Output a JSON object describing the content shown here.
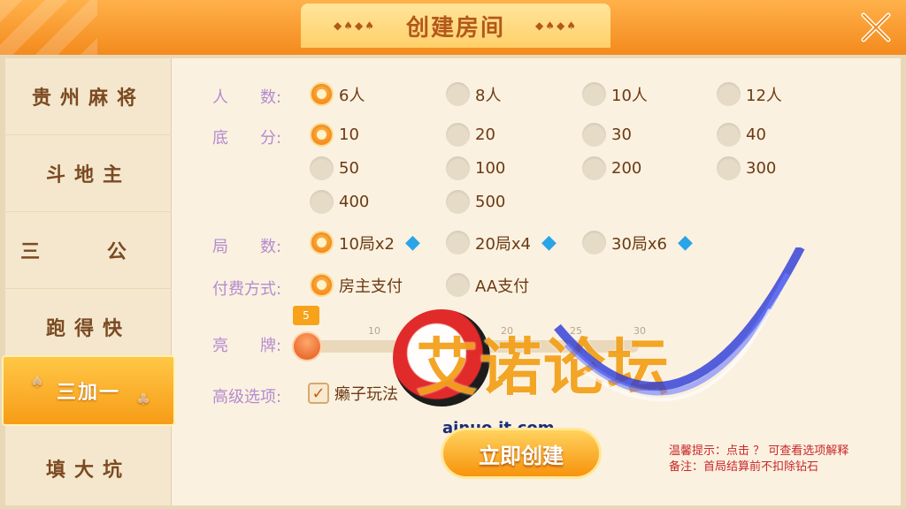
{
  "header": {
    "title": "创建房间",
    "deco": "◆♠◆♠"
  },
  "sidebar": {
    "items": [
      {
        "label": "贵州麻将"
      },
      {
        "label": "斗地主"
      },
      {
        "label": "三 公"
      },
      {
        "label": "跑得快"
      },
      {
        "label": "三加一",
        "active": true
      },
      {
        "label": "填大坑"
      }
    ]
  },
  "form": {
    "players": {
      "label": "人　　数:",
      "options": [
        "6人",
        "8人",
        "10人",
        "12人"
      ],
      "selected": "6人"
    },
    "base_score": {
      "label": "底　　分:",
      "options": [
        "10",
        "20",
        "30",
        "40",
        "50",
        "100",
        "200",
        "300",
        "400",
        "500"
      ],
      "selected": "10"
    },
    "rounds": {
      "label": "局　　数:",
      "options": [
        "10局x2",
        "20局x4",
        "30局x6"
      ],
      "selected": "10局x2"
    },
    "payment": {
      "label": "付费方式:",
      "options": [
        "房主支付",
        "AA支付"
      ],
      "selected": "房主支付"
    },
    "reveal": {
      "label": "亮　　牌:",
      "value": "5",
      "ticks": [
        "10",
        "20",
        "25",
        "30"
      ]
    },
    "advanced": {
      "label": "高级选项:",
      "option": "癞子玩法",
      "checked": true
    }
  },
  "create_button": "立即创建",
  "notes": {
    "line1": "温馨提示：点击 ？ 可查看选项解释",
    "line2": "备注：首局结算前不扣除钻石"
  },
  "watermark": {
    "text": "艾诺论坛",
    "url": "ainuo.it.com"
  },
  "colors": {
    "accent": "#f38a1d",
    "label": "#b48bd0",
    "text": "#6b3a14",
    "warning": "#c8282a"
  }
}
